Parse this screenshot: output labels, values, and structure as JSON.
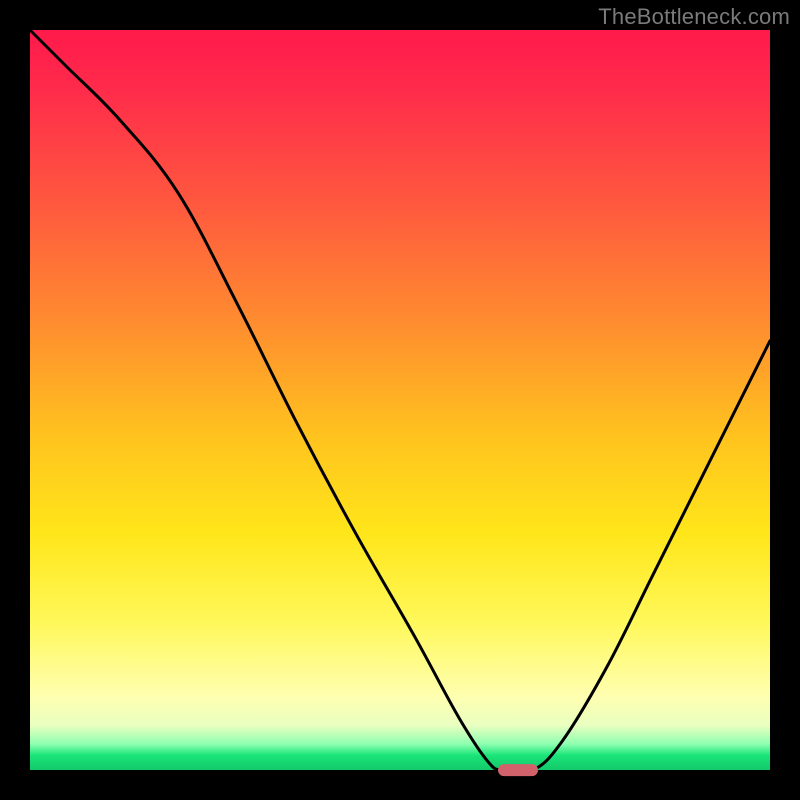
{
  "watermark": "TheBottleneck.com",
  "colors": {
    "frame": "#000000",
    "curve": "#000000",
    "marker": "#d1626c",
    "gradient_top": "#ff1a4b",
    "gradient_bottom": "#13c86a"
  },
  "chart_data": {
    "type": "line",
    "title": "",
    "xlabel": "",
    "ylabel": "",
    "xlim": [
      0,
      100
    ],
    "ylim": [
      0,
      100
    ],
    "grid": false,
    "legend": false,
    "annotations": [],
    "series": [
      {
        "name": "curve",
        "x": [
          0,
          5,
          12,
          20,
          28,
          36,
          44,
          52,
          58,
          62,
          64,
          68,
          72,
          78,
          84,
          90,
          96,
          100
        ],
        "values": [
          100,
          95,
          88,
          78,
          63,
          47,
          32,
          18,
          7,
          1,
          0,
          0,
          4,
          14,
          26,
          38,
          50,
          58
        ]
      }
    ],
    "marker": {
      "x": 66,
      "y": 0,
      "width_pct": 5.4,
      "height_pct": 1.6
    }
  }
}
